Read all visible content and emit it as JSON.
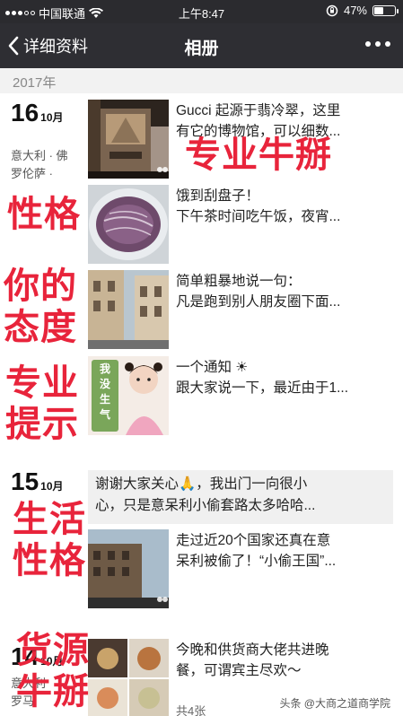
{
  "status": {
    "carrier": "中国联通",
    "time": "上午8:47",
    "battery": "47%",
    "battery_level": 0.47
  },
  "nav": {
    "back_label": "详细资料",
    "title": "相册"
  },
  "year": "2017年",
  "dates": [
    {
      "day": "16",
      "month": "10月",
      "location": [
        "意大利 · 佛",
        "罗伦萨 ·"
      ]
    },
    {
      "day": "15",
      "month": "10月"
    },
    {
      "day": "14",
      "month": "10月",
      "location": [
        "意大利",
        "罗马"
      ]
    }
  ],
  "posts": [
    {
      "lines": [
        "Gucci 起源于翡冷翠，这里",
        "有它的博物馆，可以细数..."
      ]
    },
    {
      "lines": [
        "饿到刮盘子！",
        "下午茶时间吃午饭，夜宵..."
      ]
    },
    {
      "lines": [
        "简单粗暴地说一句：",
        "凡是跑到别人朋友圈下面..."
      ]
    },
    {
      "lines": [
        "一个通知 ☀",
        "跟大家说一下，最近由于1..."
      ],
      "sign_text": [
        "我",
        "没",
        "生",
        "气"
      ]
    },
    {
      "lines": [
        "谢谢大家关心🙏，我出门一向很小",
        "心，只是意呆利小偷套路太多哈哈..."
      ]
    },
    {
      "lines": [
        "走过近20个国家还真在意",
        "呆利被偷了！“小偷王国”..."
      ]
    },
    {
      "lines": [
        "今晚和供货商大佬共进晚",
        "餐，可谓宾主尽欢～"
      ],
      "count": "共4张"
    }
  ],
  "overlays": {
    "a": "专业牛掰",
    "b": "性格",
    "c": [
      "你的",
      "态度"
    ],
    "d": [
      "专业",
      "提示"
    ],
    "e": [
      "生活",
      "性格"
    ],
    "f": [
      "货源",
      "牛掰"
    ]
  },
  "watermark": "头条 @大商之道商学院",
  "colors": {
    "overlay_red": "#e8243b",
    "nav_bg": "#2e2e33",
    "text_post_bg": "#f0f0f0"
  }
}
